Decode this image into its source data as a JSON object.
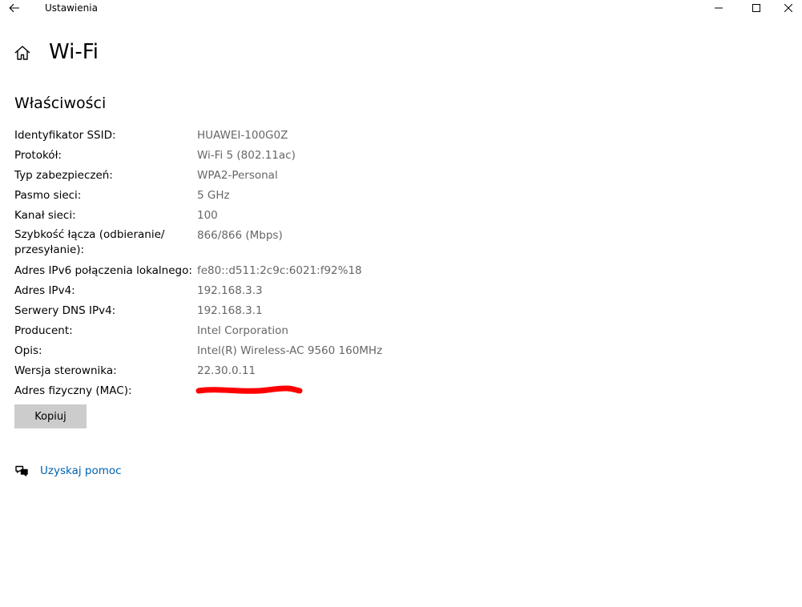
{
  "window": {
    "title": "Ustawienia"
  },
  "header": {
    "title": "Wi-Fi"
  },
  "section": {
    "title": "Właściwości"
  },
  "properties": [
    {
      "label": "Identyfikator SSID:",
      "value": "HUAWEI-100G0Z"
    },
    {
      "label": "Protokół:",
      "value": "Wi-Fi 5 (802.11ac)"
    },
    {
      "label": "Typ zabezpieczeń:",
      "value": "WPA2-Personal"
    },
    {
      "label": "Pasmo sieci:",
      "value": "5 GHz"
    },
    {
      "label": "Kanał sieci:",
      "value": "100"
    },
    {
      "label": "Szybkość łącza (odbieranie/\nprzesyłanie):",
      "value": "866/866 (Mbps)"
    },
    {
      "label": "Adres IPv6 połączenia lokalnego:",
      "value": "fe80::d511:2c9c:6021:f92%18"
    },
    {
      "label": "Adres IPv4:",
      "value": "192.168.3.3"
    },
    {
      "label": "Serwery DNS IPv4:",
      "value": "192.168.3.1"
    },
    {
      "label": "Producent:",
      "value": "Intel Corporation"
    },
    {
      "label": "Opis:",
      "value": "Intel(R) Wireless-AC 9560 160MHz"
    },
    {
      "label": "Wersja sterownika:",
      "value": "22.30.0.11"
    },
    {
      "label": "Adres fizyczny (MAC):",
      "value": ""
    }
  ],
  "copy_button": {
    "label": "Kopiuj"
  },
  "help": {
    "link_label": "Uzyskaj pomoc"
  },
  "colors": {
    "value_text": "#666666",
    "link": "#0063b1",
    "button_bg": "#cccccc",
    "redaction": "#ff0000"
  },
  "icons": {
    "back": "back-arrow-icon",
    "home": "home-icon",
    "minimize": "minimize-icon",
    "maximize": "maximize-icon",
    "close": "close-icon",
    "help": "help-chat-icon"
  }
}
